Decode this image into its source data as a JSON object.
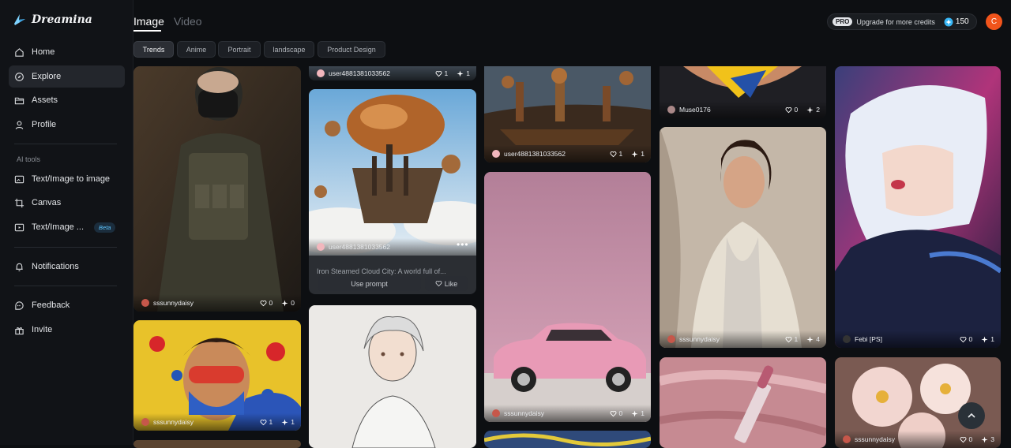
{
  "brand": {
    "name": "Dreamina"
  },
  "sidebar": {
    "items": [
      {
        "label": "Home",
        "icon": "home-icon"
      },
      {
        "label": "Explore",
        "icon": "compass-icon",
        "active": true
      },
      {
        "label": "Assets",
        "icon": "folder-icon"
      },
      {
        "label": "Profile",
        "icon": "user-icon"
      }
    ],
    "section_label": "AI tools",
    "tools": [
      {
        "label": "Text/Image to image",
        "icon": "image-edit-icon"
      },
      {
        "label": "Canvas",
        "icon": "crop-icon"
      },
      {
        "label": "Text/Image ...",
        "icon": "video-icon",
        "badge": "Beta"
      }
    ],
    "notifications": {
      "label": "Notifications",
      "icon": "bell-icon"
    },
    "bottom": [
      {
        "label": "Feedback",
        "icon": "feedback-icon"
      },
      {
        "label": "Invite",
        "icon": "gift-icon"
      }
    ]
  },
  "header": {
    "tabs": [
      {
        "label": "Image",
        "active": true
      },
      {
        "label": "Video"
      }
    ],
    "upgrade": {
      "pro": "PRO",
      "label": "Upgrade for more credits",
      "credits": "150"
    },
    "avatar_initial": "C"
  },
  "filters": [
    {
      "label": "Trends",
      "active": true
    },
    {
      "label": "Anime"
    },
    {
      "label": "Portrait"
    },
    {
      "label": "landscape"
    },
    {
      "label": "Product Design"
    }
  ],
  "cards": [
    {
      "id": "soldier",
      "user": "sssunnydaisy",
      "likes": "0",
      "remix": "0"
    },
    {
      "id": "city-top",
      "user": "user4881381033562",
      "likes": "1",
      "remix": "1"
    },
    {
      "id": "airship",
      "user": "user4881381033562",
      "description": "Iron Steamed Cloud City: A world full of...",
      "use_prompt": "Use prompt",
      "like": "Like"
    },
    {
      "id": "steampunk",
      "user": "user4881381033562",
      "likes": "1",
      "remix": "1"
    },
    {
      "id": "pinkcar",
      "user": "sssunnydaisy",
      "likes": "0",
      "remix": "1"
    },
    {
      "id": "yellow",
      "user": "Muse0176",
      "likes": "0",
      "remix": "2"
    },
    {
      "id": "woman",
      "user": "sssunnydaisy",
      "likes": "1",
      "remix": "4"
    },
    {
      "id": "anime",
      "user": "Febi [PS]",
      "likes": "0",
      "remix": "1"
    },
    {
      "id": "painted",
      "user": "sssunnydaisy",
      "likes": "1",
      "remix": "1"
    },
    {
      "id": "flowers",
      "user": "sssunnydaisy",
      "likes": "0",
      "remix": "3"
    }
  ],
  "colors": {
    "accent": "#5ec6ff",
    "avatar": "#f1541b",
    "background": "#0d0f12"
  }
}
